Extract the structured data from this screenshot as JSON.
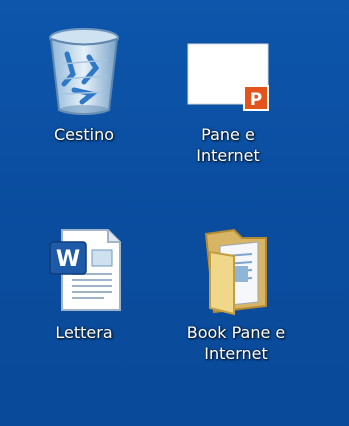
{
  "desktop": {
    "background_color": "#0b4fa4",
    "icons": [
      {
        "name": "recycle-bin",
        "icon": "recycle-bin-icon",
        "label_lines": [
          "Cestino"
        ]
      },
      {
        "name": "powerpoint-file",
        "icon": "powerpoint-file-icon",
        "label_lines": [
          "Pane e",
          "Internet"
        ],
        "badge_letter": "P"
      },
      {
        "name": "word-document",
        "icon": "word-document-icon",
        "label_lines": [
          "Lettera"
        ],
        "badge_letter": "W"
      },
      {
        "name": "folder",
        "icon": "folder-icon",
        "label_lines": [
          "Book Pane e",
          "Internet"
        ]
      }
    ]
  }
}
